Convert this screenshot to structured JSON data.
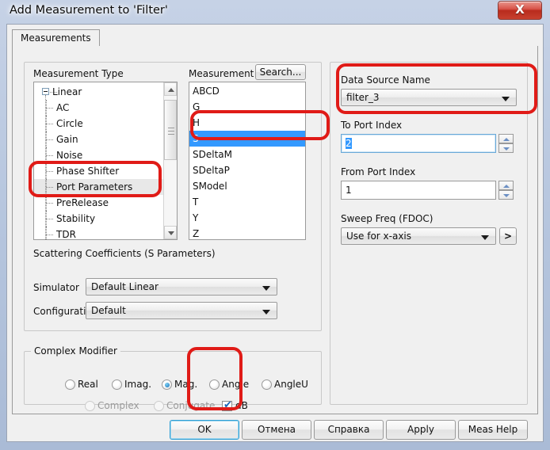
{
  "window": {
    "title": "Add Measurement to 'Filter'",
    "close_label": "X",
    "close_icon": "close-icon"
  },
  "tabs": [
    {
      "label": "Measurements",
      "active": true
    }
  ],
  "measurement_type": {
    "group_label": "Measurement Type",
    "items": [
      {
        "label": "Linear",
        "level": 0,
        "expanded": true,
        "state": "normal"
      },
      {
        "label": "AC",
        "level": 1,
        "state": "normal"
      },
      {
        "label": "Circle",
        "level": 1,
        "state": "normal"
      },
      {
        "label": "Gain",
        "level": 1,
        "state": "normal"
      },
      {
        "label": "Noise",
        "level": 1,
        "state": "normal"
      },
      {
        "label": "Phase Shifter",
        "level": 1,
        "state": "normal"
      },
      {
        "label": "Port Parameters",
        "level": 1,
        "state": "selected"
      },
      {
        "label": "PreRelease",
        "level": 1,
        "state": "normal"
      },
      {
        "label": "Stability",
        "level": 1,
        "state": "normal"
      },
      {
        "label": "TDR",
        "level": 1,
        "state": "normal"
      }
    ]
  },
  "measurement": {
    "label": "Measurement",
    "search_button": "Search...",
    "items": [
      "ABCD",
      "G",
      "H",
      "S",
      "SDeltaM",
      "SDeltaP",
      "SModel",
      "T",
      "Y",
      "Z"
    ],
    "selected": "S",
    "selected_index": 3
  },
  "description": "Scattering Coefficients (S Parameters)",
  "simulator": {
    "label": "Simulator",
    "value": "Default Linear"
  },
  "configuration": {
    "label": "Configuration",
    "value": "Default"
  },
  "right_panel": {
    "data_source": {
      "label": "Data Source Name",
      "value": "filter_3"
    },
    "to_port": {
      "label": "To Port Index",
      "value": "2",
      "selected": true
    },
    "from_port": {
      "label": "From Port Index",
      "value": "1",
      "selected": false
    },
    "sweep_freq": {
      "label": "Sweep Freq (FDOC)",
      "value": "Use for x-axis",
      "more_button": ">"
    }
  },
  "complex_modifier": {
    "group_label": "Complex Modifier",
    "row1": [
      {
        "label": "Real",
        "checked": false,
        "disabled": false
      },
      {
        "label": "Imag.",
        "checked": false,
        "disabled": false
      },
      {
        "label": "Mag.",
        "checked": true,
        "disabled": false
      },
      {
        "label": "Angle",
        "checked": false,
        "disabled": false
      },
      {
        "label": "AngleU",
        "checked": false,
        "disabled": false
      }
    ],
    "row2": [
      {
        "label": "Complex",
        "checked": false,
        "disabled": true
      },
      {
        "label": "Conjugate",
        "checked": false,
        "disabled": true
      }
    ],
    "db": {
      "label": "dB",
      "checked": true,
      "tick": "✔"
    }
  },
  "footer_buttons": [
    {
      "label": "OK",
      "default": true
    },
    {
      "label": "Отмена",
      "default": false
    },
    {
      "label": "Справка",
      "default": false
    },
    {
      "label": "Apply",
      "default": false
    },
    {
      "label": "Meas Help",
      "default": false
    }
  ],
  "annotations": {
    "color": "#e01b17",
    "shapes": [
      "port-parameters-highlight",
      "s-item-highlight",
      "data-source-highlight",
      "db-checkbox-highlight"
    ]
  }
}
